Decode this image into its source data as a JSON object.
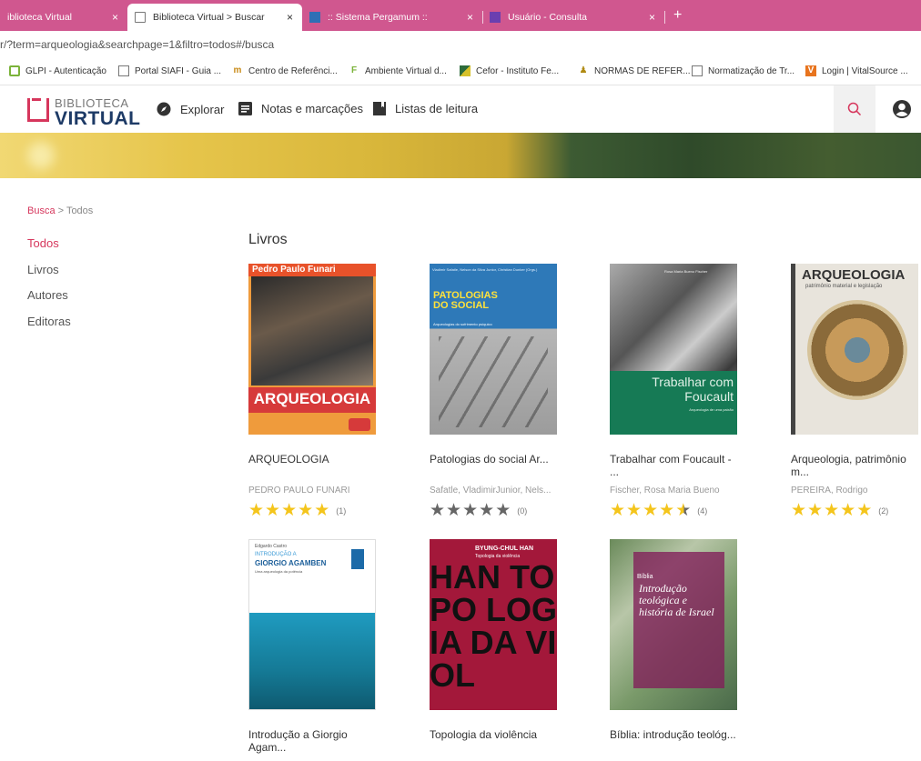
{
  "browser": {
    "tabs": [
      {
        "label": "iblioteca Virtual",
        "active": false
      },
      {
        "label": "Biblioteca Virtual > Buscar",
        "active": true
      },
      {
        "label": ":: Sistema Pergamum ::",
        "active": false
      },
      {
        "label": "Usuário - Consulta",
        "active": false
      }
    ],
    "close_glyph": "×",
    "new_tab_glyph": "+",
    "url": "r/?term=arqueologia&searchpage=1&filtro=todos#/busca",
    "bookmarks": [
      {
        "label": "GLPI - Autenticação",
        "icon": "glpi-icon"
      },
      {
        "label": "Portal SIAFI - Guia ...",
        "icon": "page-icon"
      },
      {
        "label": "Centro de Referênci...",
        "icon": "building-icon"
      },
      {
        "label": "Ambiente Virtual d...",
        "icon": "moodle-icon"
      },
      {
        "label": "Cefor - Instituto Fe...",
        "icon": "cefor-icon"
      },
      {
        "label": "NORMAS DE REFER...",
        "icon": "person-icon"
      },
      {
        "label": "Normatização de Tr...",
        "icon": "page-icon"
      },
      {
        "label": "Login | VitalSource ...",
        "icon": "vitalsource-icon"
      }
    ]
  },
  "header": {
    "logo_top": "BIBLIOTECA",
    "logo_bottom": "VIRTUAL",
    "nav": [
      {
        "label": "Explorar",
        "icon": "compass-icon"
      },
      {
        "label": "Notas e marcações",
        "icon": "notes-icon"
      },
      {
        "label": "Listas de leitura",
        "icon": "bookmark-icon"
      }
    ]
  },
  "breadcrumb": {
    "link": "Busca",
    "sep": ">",
    "current": "Todos"
  },
  "sidebar": {
    "items": [
      {
        "label": "Todos",
        "active": true
      },
      {
        "label": "Livros",
        "active": false
      },
      {
        "label": "Autores",
        "active": false
      },
      {
        "label": "Editoras",
        "active": false
      }
    ]
  },
  "section_title": "Livros",
  "books": [
    {
      "title": "ARQUEOLOGIA",
      "author": "PEDRO PAULO FUNARI",
      "rating": 5,
      "count": "(1)",
      "cover": {
        "top_text": "Pedro Paulo Funari",
        "main_text": "ARQUEOLOGIA"
      }
    },
    {
      "title": "Patologias do social Ar...",
      "author": "Safatle, VladimirJunior, Nels...",
      "rating": 0,
      "count": "(0)",
      "cover": {
        "top_text": "Vladimir Safatle, Nelson da Silva Junior, Christian Dunker (Orgs.)",
        "main_text": "PATOLOGIAS DO SOCIAL",
        "sub_text": "Arqueologias do sofrimento psíquico"
      }
    },
    {
      "title": "Trabalhar com Foucault - ...",
      "author": "Fischer, Rosa Maria Bueno",
      "rating": 4.5,
      "count": "(4)",
      "cover": {
        "top_text": "Rosa Maria Bueno Fischer",
        "main_text": "Trabalhar com Foucault",
        "sub_text": "Arqueologia de uma paixão"
      }
    },
    {
      "title": "Arqueologia, patrimônio m...",
      "author": "PEREIRA, Rodrigo",
      "rating": 5,
      "count": "(2)",
      "cover": {
        "main_text": "ARQUEOLOGIA",
        "sub_text": "patrimônio material e legislação"
      }
    },
    {
      "title": "Introdução a Giorgio Agam...",
      "author": "",
      "rating": null,
      "count": "",
      "cover": {
        "top_text": "Edgardo Castro",
        "main_text": "GIORGIO AGAMBEN",
        "pre_text": "INTRODUÇÃO A",
        "sub_text": "Uma arqueologia da potência"
      }
    },
    {
      "title": "Topologia da violência",
      "author": "",
      "rating": null,
      "count": "",
      "cover": {
        "top_text": "BYUNG-CHUL HAN",
        "sub_text": "Topologia da violência",
        "main_text": "HAN TOPO LOGIA DA VIOL"
      }
    },
    {
      "title": "Bíblia: introdução teológ...",
      "author": "",
      "rating": null,
      "count": "",
      "cover": {
        "main_text": "Introdução teológica e história de Israel",
        "pre_text": "Bíblia"
      }
    }
  ],
  "colors": {
    "accent": "#d6365c",
    "navy": "#1d3a66",
    "star": "#f4c51c",
    "tabbar": "#d0578f"
  }
}
